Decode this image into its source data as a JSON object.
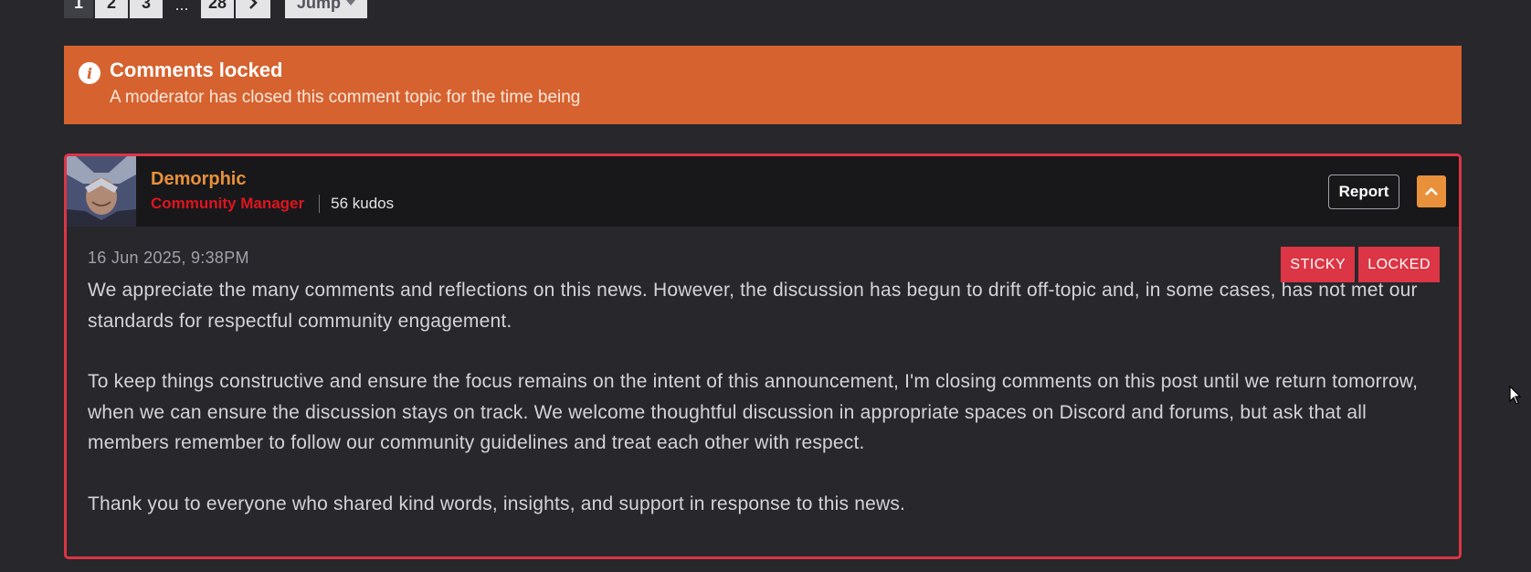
{
  "pagination": {
    "pages": [
      "1",
      "2",
      "3"
    ],
    "ellipsis": "...",
    "last_page": "28",
    "jump_label": "Jump"
  },
  "banner": {
    "title": "Comments locked",
    "text": "A moderator has closed this comment topic for the time being",
    "icon": "info-icon"
  },
  "comment": {
    "author": "Demorphic",
    "role": "Community Manager",
    "kudos": "56 kudos",
    "report_label": "Report",
    "timestamp": "16 Jun 2025, 9:38PM",
    "badges": [
      "STICKY",
      "LOCKED"
    ],
    "paragraphs": [
      "We appreciate the many comments and reflections on this news. However, the discussion has begun to drift off-topic and, in some cases, has not met our standards for respectful community engagement.",
      "To keep things constructive and ensure the focus remains on the intent of this announcement, I'm closing comments on this post until we return tomorrow, when we can ensure the discussion stays on track. We welcome thoughtful discussion in appropriate spaces on Discord and forums, but ask that all members remember to follow our community guidelines and treat each other with respect.",
      "Thank you to everyone who shared kind words, insights, and support in response to this news."
    ]
  },
  "colors": {
    "banner": "#d6622f",
    "author_name": "#e8913a",
    "role": "#e0141e",
    "badge": "#dc3545",
    "card_border": "#dc3545"
  }
}
